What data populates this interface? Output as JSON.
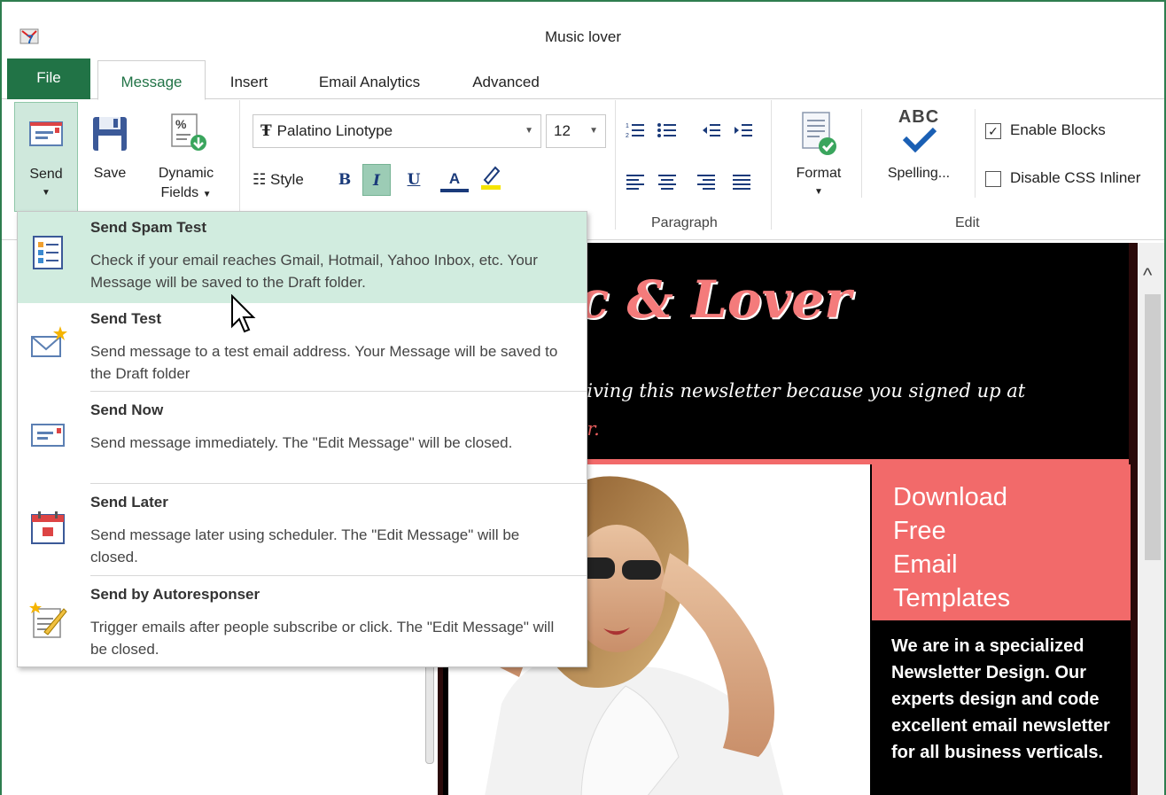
{
  "window": {
    "title": "Music lover"
  },
  "tabs": {
    "file": "File",
    "message": "Message",
    "insert": "Insert",
    "analytics": "Email Analytics",
    "advanced": "Advanced"
  },
  "ribbon": {
    "send_label": "Send",
    "save_label": "Save",
    "dynamic_label_1": "Dynamic",
    "dynamic_label_2": "Fields",
    "font_name": "Palatino Linotype",
    "font_size": "12",
    "style_label": "Style",
    "bold": "B",
    "italic": "I",
    "underline": "U",
    "font_color": "A",
    "paragraph_label": "Paragraph",
    "format_label": "Format",
    "spelling_label": "Spelling...",
    "spelling_icon_text": "ABC",
    "enable_blocks": "Enable Blocks",
    "disable_css": "Disable CSS Inliner",
    "edit_label": "Edit",
    "enable_blocks_checked": true,
    "disable_css_checked": false
  },
  "send_menu": {
    "items": [
      {
        "title": "Send Spam Test",
        "desc": "Check if your email reaches Gmail, Hotmail, Yahoo Inbox, etc. Your Message will be saved to the Draft folder.",
        "icon": "checklist-icon"
      },
      {
        "title": "Send Test",
        "desc": "Send message to a test email address. Your Message will be saved to the Draft folder",
        "icon": "envelope-star-icon"
      },
      {
        "title": "Send Now",
        "desc": "Send message immediately. The \"Edit Message\" will be closed.",
        "icon": "envelope-send-icon"
      },
      {
        "title": "Send Later",
        "desc": "Send message later using scheduler.  The \"Edit Message\" will be closed.",
        "icon": "calendar-icon"
      },
      {
        "title": "Send by Autoresponser",
        "desc": "Trigger emails after people subscribe or click. The \"Edit Message\" will be closed.",
        "icon": "autoresponder-icon"
      }
    ]
  },
  "email": {
    "banner_title": "ic & Lover",
    "banner_text": "eiving this newsletter because you signed up at",
    "banner_link": "er.",
    "cta_lines": [
      "Download",
      "Free",
      "Email",
      "Templates"
    ],
    "info_text": "We are in a specialized Newsletter Design. Our experts design and code excellent email newsletter for all business verticals."
  },
  "colors": {
    "accent": "#217346",
    "highlight": "#d1ecdf",
    "cta": "#f26a6a"
  }
}
